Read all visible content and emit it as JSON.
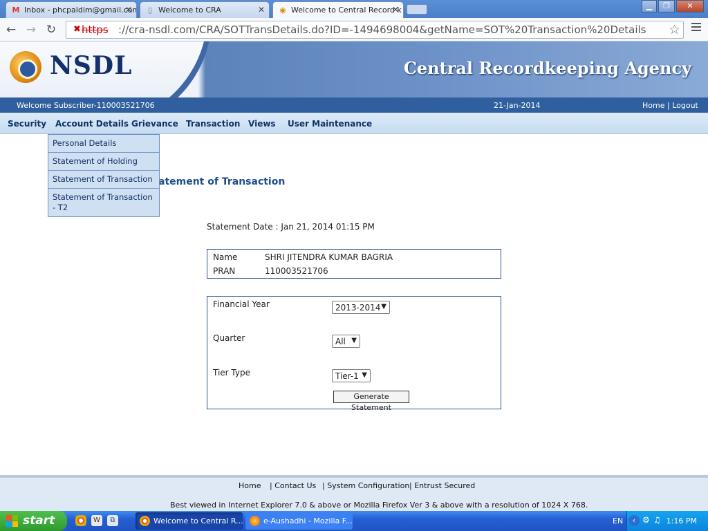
{
  "browser": {
    "tabs": [
      {
        "title": "Inbox - phcpaldim@gmail.com",
        "icon": "gmail-icon"
      },
      {
        "title": "Welcome to CRA",
        "icon": "page-icon"
      },
      {
        "title": "Welcome to Central Record k",
        "icon": "nsdl-icon",
        "active": true
      }
    ],
    "url_scheme": "https",
    "url_rest": "://cra-nsdl.com/CRA/SOTTransDetails.do?ID=-1494698004&getName=SOT%20Transaction%20Details"
  },
  "header": {
    "brand": "NSDL",
    "agency": "Central Recordkeeping Agency",
    "welcome": "Welcome Subscriber-110003521706",
    "date": "21-Jan-2014",
    "home_link": "Home",
    "separator": "|",
    "logout_link": "Logout"
  },
  "nav": [
    "Security",
    "Account Details",
    "Grievance",
    "Transaction",
    "Views",
    "User Maintenance"
  ],
  "account_menu": [
    "Personal Details",
    "Statement of Holding",
    "Statement of Transaction",
    "Statement of Transaction - T2"
  ],
  "page": {
    "heading": "atement of Transaction",
    "statement_date": "Statement Date : Jan 21, 2014 01:15 PM",
    "subscriber": {
      "name_label": "Name",
      "name_value": "SHRI JITENDRA KUMAR BAGRIA",
      "pran_label": "PRAN",
      "pran_value": "110003521706"
    },
    "form": {
      "financial_year_label": "Financial Year",
      "financial_year_value": "2013-2014",
      "quarter_label": "Quarter",
      "quarter_value": "All",
      "tier_label": "Tier Type",
      "tier_value": "Tier-1",
      "generate_button": "Generate Statement"
    }
  },
  "footer": {
    "links": [
      "Home",
      "| Contact Us",
      "| System Configuration",
      "| Entrust Secured"
    ],
    "note": "Best viewed in Internet Explorer 7.0 & above or Mozilla Firefox Ver 3 & above with a resolution of 1024 X 768."
  },
  "taskbar": {
    "start_label": "start",
    "tasks": [
      "Welcome to Central R...",
      "e-Aushadhi - Mozilla F..."
    ],
    "language": "EN",
    "clock": "1:16 PM"
  },
  "colors": {
    "header_blue": "#2f5f9e",
    "nav_text": "#0f3265",
    "heading": "#1f4f8a"
  }
}
